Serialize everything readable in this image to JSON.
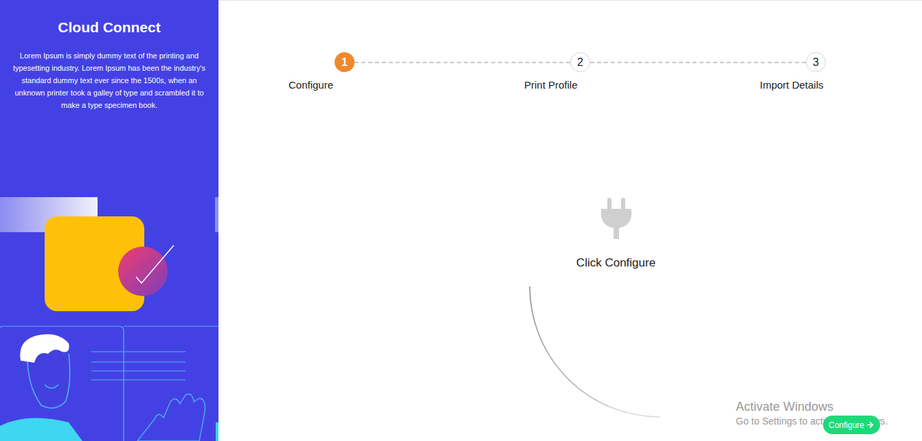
{
  "sidebar": {
    "title": "Cloud Connect",
    "description": "Lorem Ipsum is simply dummy text of the printing and typesetting industry. Lorem Ipsum has been the industry's standard dummy text ever since the 1500s, when an unknown printer took a galley of type and scrambled it to make a type specimen book."
  },
  "steps": [
    {
      "number": "1",
      "label": "Configure",
      "selected": true
    },
    {
      "number": "2",
      "label": "Print Profile",
      "selected": false
    },
    {
      "number": "3",
      "label": "Import Details",
      "selected": false
    }
  ],
  "empty_state": {
    "message": "Click Configure"
  },
  "buttons": [
    {
      "label": "Configure"
    }
  ],
  "watermark": {
    "title": "Activate Windows",
    "subtitle": "Go to Settings to activate Windows."
  }
}
